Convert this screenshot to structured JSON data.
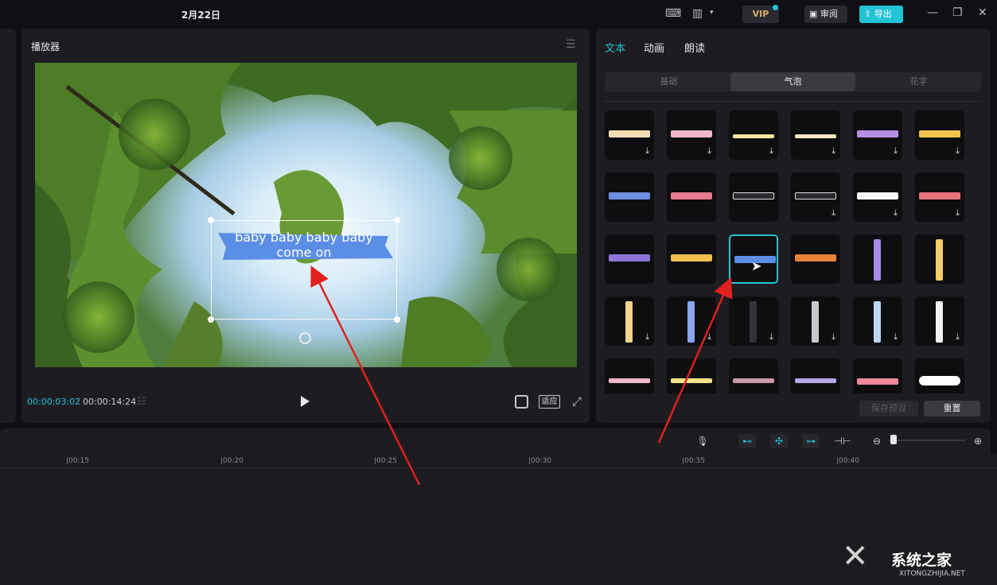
{
  "titlebar": {
    "title": "2月22日",
    "vip_label": "VIP",
    "review_label": "审阅",
    "export_label": "导出"
  },
  "player": {
    "title": "播放器",
    "subtitle_line1": "baby baby baby baby",
    "subtitle_line2": "come on",
    "time_current": "00:00:03:02",
    "time_separator": "/",
    "time_total": "00:00:14:24",
    "fit_label": "适应"
  },
  "right_panel": {
    "tabs": [
      {
        "label": "文本",
        "active": true
      },
      {
        "label": "动画",
        "active": false
      },
      {
        "label": "朗读",
        "active": false
      }
    ],
    "subtabs": [
      {
        "label": "基础",
        "active": false
      },
      {
        "label": "气泡",
        "active": true
      },
      {
        "label": "花字",
        "active": false
      }
    ],
    "save_preset_label": "保存预设",
    "reset_label": "重置"
  },
  "timeline": {
    "ticks": [
      "|00:15",
      "|00:20",
      "|00:25",
      "|00:30",
      "|00:35",
      "|00:40"
    ]
  },
  "watermark": {
    "main": "系统之家",
    "sub": "XITONGZHIJIA.NET"
  },
  "colors": {
    "accent": "#22c3d4",
    "panel": "#1d1d21",
    "background": "#101014",
    "annotation_arrow": "#e0211f"
  }
}
